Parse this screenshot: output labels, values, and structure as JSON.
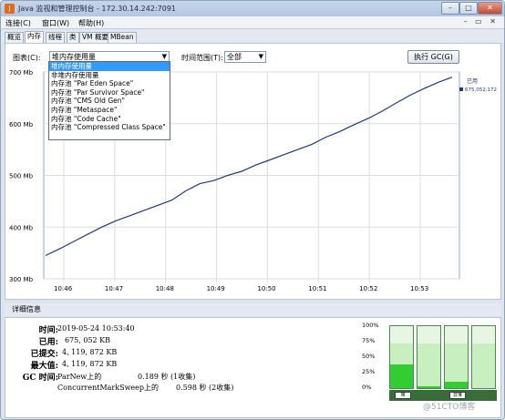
{
  "window": {
    "title": "Java 监视和管理控制台 - 172.30.14.242:7091",
    "icon_label": "J"
  },
  "menubar": {
    "items": [
      "连接(C)",
      "窗口(W)",
      "帮助(H)"
    ]
  },
  "tabs": [
    "概览",
    "内存",
    "线程",
    "类",
    "VM 概要",
    "MBean"
  ],
  "active_tab": 1,
  "toolbar": {
    "chart_label": "图表(C):",
    "chart_value": "堆内存使用量",
    "time_label": "时间范围(T):",
    "time_value": "全部",
    "gc_button": "执行 GC(G)"
  },
  "dropdown": {
    "items": [
      "堆内存使用量",
      "非堆内存使用量",
      "内存池 \"Par Eden Space\"",
      "内存池 \"Par Survivor Space\"",
      "内存池 \"CMS Old Gen\"",
      "内存池 \"Metaspace\"",
      "内存池 \"Code Cache\"",
      "内存池 \"Compressed Class Space\""
    ],
    "selected": 0
  },
  "chart_data": {
    "type": "line",
    "series": [
      {
        "name": "已用",
        "values": [
          345,
          358,
          372,
          386,
          400,
          412,
          422,
          432,
          442,
          452,
          470,
          484,
          490,
          500,
          508,
          520,
          530,
          540,
          550,
          560,
          574,
          585,
          598,
          610,
          624,
          640,
          655,
          668,
          680,
          690
        ]
      }
    ],
    "x": [
      "10:45:30",
      "10:46",
      "10:46:15",
      "10:46:30",
      "10:47",
      "10:47:15",
      "10:47:30",
      "10:48",
      "10:48:15",
      "10:48:30",
      "10:49",
      "10:49:15",
      "10:49:30",
      "10:49:45",
      "10:50",
      "10:50:15",
      "10:50:30",
      "10:50:45",
      "10:51",
      "10:51:15",
      "10:51:30",
      "10:52",
      "10:52:15",
      "10:52:30",
      "10:52:45",
      "10:53",
      "10:53:15",
      "10:53:30",
      "10:53:40",
      "10:53:45"
    ],
    "ylim": [
      300,
      700
    ],
    "y_ticks": [
      "700 Mb",
      "600 Mb",
      "500 Mb",
      "400 Mb",
      "300 Mb"
    ],
    "x_ticks": [
      "10:46",
      "10:47",
      "10:48",
      "10:49",
      "10:50",
      "10:51",
      "10:52",
      "10:53"
    ],
    "legend": {
      "name": "已用",
      "value": "675,052,172"
    },
    "grid": true
  },
  "details": {
    "header": "详细信息",
    "rows": [
      {
        "key": "时间:",
        "value": "2019-05-24 10:53:40"
      },
      {
        "key": "已用:",
        "value": "675, 052 KB"
      },
      {
        "key": "已提交:",
        "value": "4, 119, 872 KB"
      },
      {
        "key": "最大值:",
        "value": "4, 119, 872 KB"
      }
    ],
    "gc_key": "GC 时间:",
    "gc_rows": [
      {
        "name": "ParNew上的",
        "time": "0.189 秒 (1收集)"
      },
      {
        "name": "ConcurrentMarkSweep上的",
        "time": "0.598 秒 (2收集)"
      }
    ]
  },
  "pool_bars": {
    "axis": [
      "100%",
      "75%",
      "50%",
      "25%",
      "0%"
    ],
    "pools": [
      {
        "used": 0.38,
        "committed": 1.0,
        "color": "#33cc33"
      },
      {
        "used": 0.03,
        "committed": 1.0,
        "color": "#33cc33"
      },
      {
        "used": 0.1,
        "committed": 1.0,
        "color": "#33cc33"
      },
      {
        "used": 0.0,
        "committed": 1.0,
        "color": "#33cc33"
      }
    ],
    "tags": [
      "堆",
      "非堆"
    ]
  },
  "watermark": "@51CTO博客"
}
